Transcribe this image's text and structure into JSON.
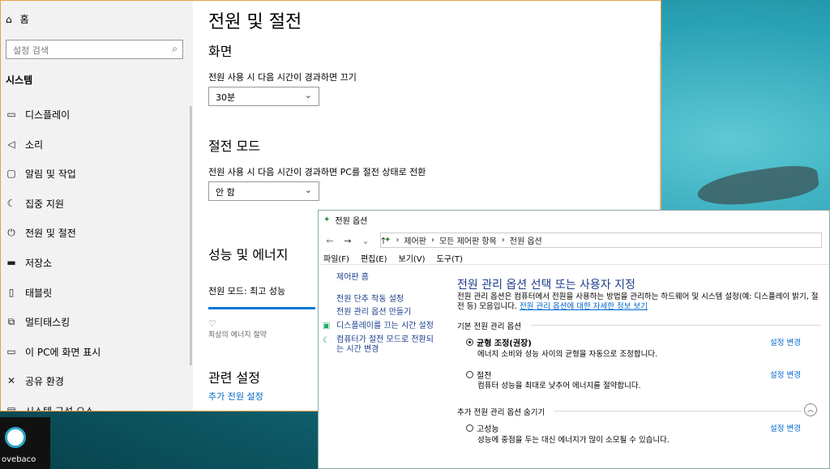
{
  "settings": {
    "home": "홈",
    "search_placeholder": "설정 검색",
    "section": "시스템",
    "sidebar_items": [
      {
        "icon": "monitor-icon",
        "label": "디스플레이"
      },
      {
        "icon": "speaker-icon",
        "label": "소리"
      },
      {
        "icon": "notification-icon",
        "label": "알림 및 작업"
      },
      {
        "icon": "moon-icon",
        "label": "집중 지원"
      },
      {
        "icon": "power-icon",
        "label": "전원 및 절전"
      },
      {
        "icon": "storage-icon",
        "label": "저장소"
      },
      {
        "icon": "tablet-icon",
        "label": "태블릿"
      },
      {
        "icon": "multitask-icon",
        "label": "멀티태스킹"
      },
      {
        "icon": "project-icon",
        "label": "이 PC에 화면 표시"
      },
      {
        "icon": "share-icon",
        "label": "공유 환경"
      },
      {
        "icon": "clipboard-icon",
        "label": "시스템 구성 요소"
      }
    ],
    "page_title": "전원 및 절전",
    "screen_heading": "화면",
    "screen_label": "전원 사용 시 다음 시간이 경과하면 끄기",
    "screen_value": "30분",
    "sleep_heading": "절전 모드",
    "sleep_label": "전원 사용 시 다음 시간이 경과하면 PC를 절전 상태로 전환",
    "sleep_value": "안 함",
    "perf_heading": "성능 및 에너지",
    "power_mode_label": "전원 모드: 최고 성능",
    "slider_caption": "최상의 에너지 절약",
    "related_heading": "관련 설정",
    "related_link": "추가 전원 설정"
  },
  "power": {
    "title": "전원 옵션",
    "breadcrumb": [
      "제어판",
      "모든 제어판 항목",
      "전원 옵션"
    ],
    "menu": [
      "파일(F)",
      "편집(E)",
      "보기(V)",
      "도구(T)"
    ],
    "left_links": [
      "제어판 홈",
      "전원 단추 작동 설정",
      "전원 관리 옵션 만들기",
      "디스플레이를 끄는 시간 설정",
      "컴퓨터가 절전 모드로 전환되는 시간 변경"
    ],
    "heading": "전원 관리 옵션 선택 또는 사용자 지정",
    "desc": "전원 관리 옵션은 컴퓨터에서 전원을 사용하는 방법을 관리하는 하드웨어 및 시스템 설정(예: 디스플레이 밝기, 절전 등) 모음입니다.",
    "desc_link": "전원 관리 옵션에 대한 자세한 정보 보기",
    "group_basic": "기본 전원 관리 옵션",
    "group_more": "추가 전원 관리 옵션 숨기기",
    "change_label": "설정 변경",
    "plans": [
      {
        "name": "균형 조정(권장)",
        "desc": "에너지 소비와 성능 사이의 균형을 자동으로 조정합니다.",
        "selected": true
      },
      {
        "name": "절전",
        "desc": "컴퓨터 성능을 최대로 낮추어 에너지를 절약합니다.",
        "selected": false
      },
      {
        "name": "고성능",
        "desc": "성능에 중점을 두는 대신 에너지가 많이 소모될 수 있습니다.",
        "selected": false
      }
    ]
  },
  "taskbar": {
    "label": "ovebaco"
  }
}
